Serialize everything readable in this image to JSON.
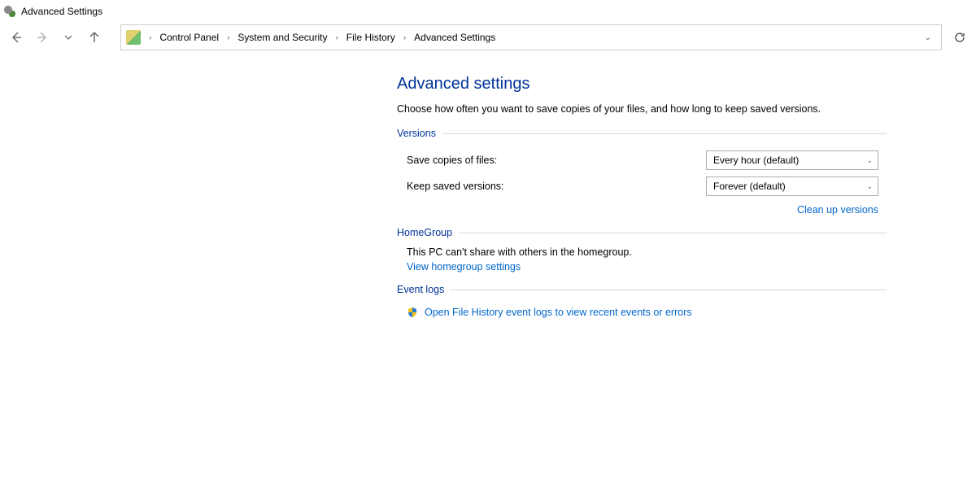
{
  "window": {
    "title": "Advanced Settings"
  },
  "breadcrumbs": {
    "items": [
      "Control Panel",
      "System and Security",
      "File History",
      "Advanced Settings"
    ]
  },
  "page": {
    "title": "Advanced settings",
    "description": "Choose how often you want to save copies of your files, and how long to keep saved versions."
  },
  "versions": {
    "section_title": "Versions",
    "save_label": "Save copies of files:",
    "save_value": "Every hour (default)",
    "keep_label": "Keep saved versions:",
    "keep_value": "Forever (default)",
    "cleanup_link": "Clean up versions"
  },
  "homegroup": {
    "section_title": "HomeGroup",
    "text": "This PC can't share with others in the homegroup.",
    "link": "View homegroup settings"
  },
  "eventlogs": {
    "section_title": "Event logs",
    "link": "Open File History event logs to view recent events or errors"
  }
}
